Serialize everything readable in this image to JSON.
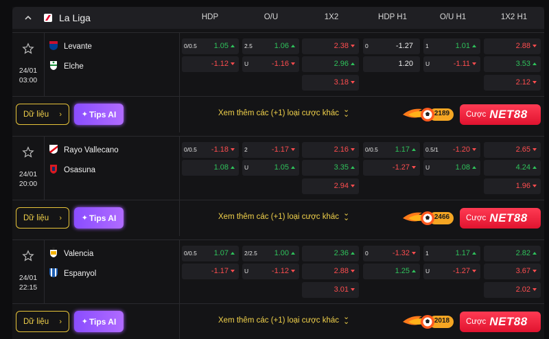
{
  "league": {
    "name": "La Liga",
    "columns": [
      "HDP",
      "O/U",
      "1X2",
      "HDP H1",
      "O/U H1",
      "1X2 H1"
    ]
  },
  "actions": {
    "data_label": "Dữ liệu",
    "tips_label": "Tips AI",
    "more_label": "Xem thêm các (+1) loại cược khác",
    "bet_label": "Cược",
    "brand": "NET88"
  },
  "colors": {
    "up": "#2fc25b",
    "down": "#ff4d4f",
    "accent_yellow": "#e9c53a",
    "tips_purple": "#9b59ff",
    "bet_red": "#ff2d46"
  },
  "matches": [
    {
      "date": "24/01",
      "time": "03:00",
      "home": "Levante",
      "away": "Elche",
      "fire_count": "2189",
      "rows": [
        {
          "hdp_hc": "0/0.5",
          "hdp": "1.05",
          "hdp_dir": "up",
          "ou_hc": "2.5",
          "ou": "1.06",
          "ou_dir": "up",
          "x12": "2.38",
          "x12_dir": "down",
          "hdph1_hc": "0",
          "hdph1": "-1.27",
          "hdph1_dir": "none",
          "ouh1_hc": "1",
          "ouh1": "1.01",
          "ouh1_dir": "up",
          "x12h1": "2.88",
          "x12h1_dir": "down"
        },
        {
          "hdp_hc": "",
          "hdp": "-1.12",
          "hdp_dir": "down",
          "ou_hc": "U",
          "ou": "-1.16",
          "ou_dir": "down",
          "x12": "2.96",
          "x12_dir": "up",
          "hdph1_hc": "",
          "hdph1": "1.20",
          "hdph1_dir": "none",
          "ouh1_hc": "U",
          "ouh1": "-1.11",
          "ouh1_dir": "down",
          "x12h1": "3.53",
          "x12h1_dir": "up"
        },
        {
          "x12": "3.18",
          "x12_dir": "down",
          "x12h1": "2.12",
          "x12h1_dir": "down"
        }
      ]
    },
    {
      "date": "24/01",
      "time": "20:00",
      "home": "Rayo Vallecano",
      "away": "Osasuna",
      "fire_count": "2466",
      "rows": [
        {
          "hdp_hc": "0/0.5",
          "hdp": "-1.18",
          "hdp_dir": "down",
          "ou_hc": "2",
          "ou": "-1.17",
          "ou_dir": "down",
          "x12": "2.16",
          "x12_dir": "down",
          "hdph1_hc": "0/0.5",
          "hdph1": "1.17",
          "hdph1_dir": "up",
          "ouh1_hc": "0.5/1",
          "ouh1": "-1.20",
          "ouh1_dir": "down",
          "x12h1": "2.65",
          "x12h1_dir": "down"
        },
        {
          "hdp_hc": "",
          "hdp": "1.08",
          "hdp_dir": "up",
          "ou_hc": "U",
          "ou": "1.05",
          "ou_dir": "up",
          "x12": "3.35",
          "x12_dir": "up",
          "hdph1_hc": "",
          "hdph1": "-1.27",
          "hdph1_dir": "down",
          "ouh1_hc": "U",
          "ouh1": "1.08",
          "ouh1_dir": "up",
          "x12h1": "4.24",
          "x12h1_dir": "up"
        },
        {
          "x12": "2.94",
          "x12_dir": "down",
          "x12h1": "1.96",
          "x12h1_dir": "down"
        }
      ]
    },
    {
      "date": "24/01",
      "time": "22:15",
      "home": "Valencia",
      "away": "Espanyol",
      "fire_count": "2018",
      "rows": [
        {
          "hdp_hc": "0/0.5",
          "hdp": "1.07",
          "hdp_dir": "up",
          "ou_hc": "2/2.5",
          "ou": "1.00",
          "ou_dir": "up",
          "x12": "2.36",
          "x12_dir": "up",
          "hdph1_hc": "0",
          "hdph1": "-1.32",
          "hdph1_dir": "down",
          "ouh1_hc": "1",
          "ouh1": "1.17",
          "ouh1_dir": "up",
          "x12h1": "2.82",
          "x12h1_dir": "up"
        },
        {
          "hdp_hc": "",
          "hdp": "-1.17",
          "hdp_dir": "down",
          "ou_hc": "U",
          "ou": "-1.12",
          "ou_dir": "down",
          "x12": "2.88",
          "x12_dir": "down",
          "hdph1_hc": "",
          "hdph1": "1.25",
          "hdph1_dir": "up",
          "ouh1_hc": "U",
          "ouh1": "-1.27",
          "ouh1_dir": "down",
          "x12h1": "3.67",
          "x12h1_dir": "down"
        },
        {
          "x12": "3.01",
          "x12_dir": "down",
          "x12h1": "2.02",
          "x12h1_dir": "down"
        }
      ]
    }
  ]
}
